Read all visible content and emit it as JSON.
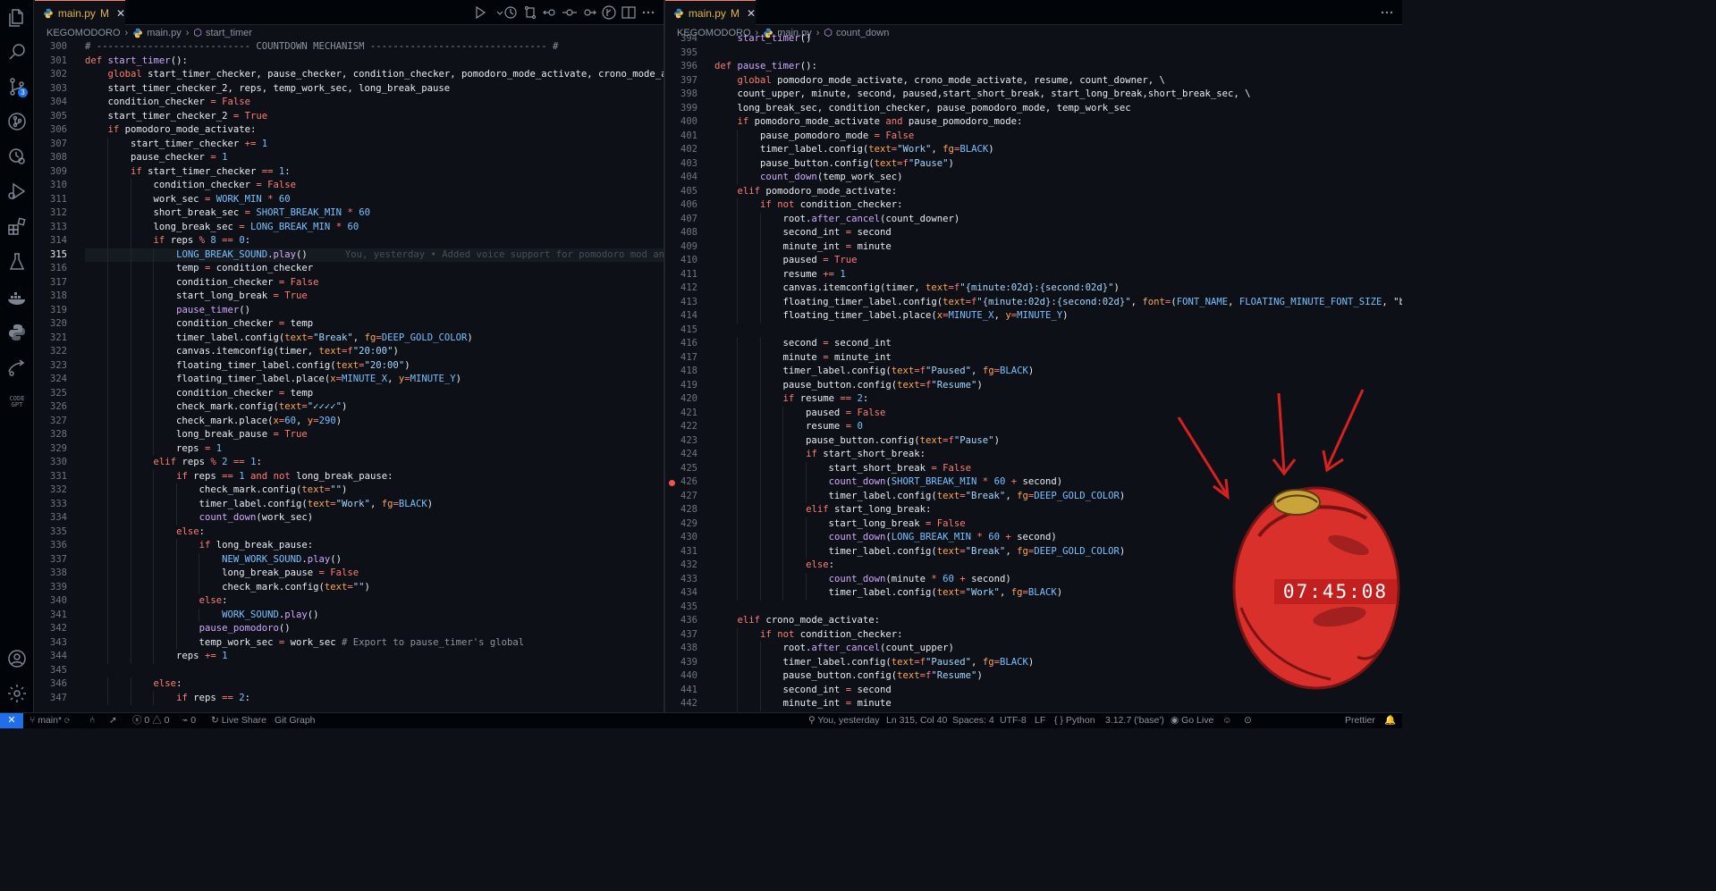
{
  "left_pane": {
    "tab": {
      "filename": "main.py",
      "status": "M"
    },
    "breadcrumb": {
      "project": "KEGOMODORO",
      "file": "main.py",
      "symbol": "start_timer"
    },
    "current_line": 315,
    "blame": "You, yesterday • Added voice support for pomodoro mod and",
    "lines": [
      {
        "n": 300,
        "t": "# --------------------------- COUNTDOWN MECHANISM ------------------------------- #"
      },
      {
        "n": 301,
        "t": "def start_timer():"
      },
      {
        "n": 302,
        "t": "    global start_timer_checker, pause_checker, condition_checker, pomodoro_mode_activate, crono_mode_ac"
      },
      {
        "n": 303,
        "t": "    start_timer_checker_2, reps, temp_work_sec, long_break_pause"
      },
      {
        "n": 304,
        "t": "    condition_checker = False"
      },
      {
        "n": 305,
        "t": "    start_timer_checker_2 = True"
      },
      {
        "n": 306,
        "t": "    if pomodoro_mode_activate:"
      },
      {
        "n": 307,
        "t": "        start_timer_checker += 1"
      },
      {
        "n": 308,
        "t": "        pause_checker = 1"
      },
      {
        "n": 309,
        "t": "        if start_timer_checker == 1:"
      },
      {
        "n": 310,
        "t": "            condition_checker = False"
      },
      {
        "n": 311,
        "t": "            work_sec = WORK_MIN * 60"
      },
      {
        "n": 312,
        "t": "            short_break_sec = SHORT_BREAK_MIN * 60"
      },
      {
        "n": 313,
        "t": "            long_break_sec = LONG_BREAK_MIN * 60"
      },
      {
        "n": 314,
        "t": "            if reps % 8 == 0:"
      },
      {
        "n": 315,
        "t": "                LONG_BREAK_SOUND.play()"
      },
      {
        "n": 316,
        "t": "                temp = condition_checker"
      },
      {
        "n": 317,
        "t": "                condition_checker = False"
      },
      {
        "n": 318,
        "t": "                start_long_break = True"
      },
      {
        "n": 319,
        "t": "                pause_timer()"
      },
      {
        "n": 320,
        "t": "                condition_checker = temp"
      },
      {
        "n": 321,
        "t": "                timer_label.config(text=\"Break\", fg=DEEP_GOLD_COLOR)"
      },
      {
        "n": 322,
        "t": "                canvas.itemconfig(timer, text=f\"20:00\")"
      },
      {
        "n": 323,
        "t": "                floating_timer_label.config(text=\"20:00\")"
      },
      {
        "n": 324,
        "t": "                floating_timer_label.place(x=MINUTE_X, y=MINUTE_Y)"
      },
      {
        "n": 325,
        "t": "                condition_checker = temp"
      },
      {
        "n": 326,
        "t": "                check_mark.config(text=\"✓✓✓✓\")"
      },
      {
        "n": 327,
        "t": "                check_mark.place(x=60, y=290)"
      },
      {
        "n": 328,
        "t": "                long_break_pause = True"
      },
      {
        "n": 329,
        "t": "                reps = 1"
      },
      {
        "n": 330,
        "t": "            elif reps % 2 == 1:"
      },
      {
        "n": 331,
        "t": "                if reps == 1 and not long_break_pause:"
      },
      {
        "n": 332,
        "t": "                    check_mark.config(text=\"\")"
      },
      {
        "n": 333,
        "t": "                    timer_label.config(text=\"Work\", fg=BLACK)"
      },
      {
        "n": 334,
        "t": "                    count_down(work_sec)"
      },
      {
        "n": 335,
        "t": "                else:"
      },
      {
        "n": 336,
        "t": "                    if long_break_pause:"
      },
      {
        "n": 337,
        "t": "                        NEW_WORK_SOUND.play()"
      },
      {
        "n": 338,
        "t": "                        long_break_pause = False"
      },
      {
        "n": 339,
        "t": "                        check_mark.config(text=\"\")"
      },
      {
        "n": 340,
        "t": "                    else:"
      },
      {
        "n": 341,
        "t": "                        WORK_SOUND.play()"
      },
      {
        "n": 342,
        "t": "                    pause_pomodoro()"
      },
      {
        "n": 343,
        "t": "                    temp_work_sec = work_sec # Export to pause_timer's global"
      },
      {
        "n": 344,
        "t": "                reps += 1"
      },
      {
        "n": 345,
        "t": ""
      },
      {
        "n": 346,
        "t": "            else:"
      },
      {
        "n": 347,
        "t": "                if reps == 2:"
      }
    ]
  },
  "right_pane": {
    "tab": {
      "filename": "main.py",
      "status": "M"
    },
    "breadcrumb": {
      "project": "KEGOMODORO",
      "file": "main.py",
      "symbol": "count_down"
    },
    "first_line_partial": {
      "n": 394,
      "t": "    start_timer()"
    },
    "breakpoint_line": 426,
    "lines": [
      {
        "n": 395,
        "t": ""
      },
      {
        "n": 396,
        "t": "def pause_timer():"
      },
      {
        "n": 397,
        "t": "    global pomodoro_mode_activate, crono_mode_activate, resume, count_downer, \\"
      },
      {
        "n": 398,
        "t": "    count_upper, minute, second, paused,start_short_break, start_long_break,short_break_sec, \\"
      },
      {
        "n": 399,
        "t": "    long_break_sec, condition_checker, pause_pomodoro_mode, temp_work_sec"
      },
      {
        "n": 400,
        "t": "    if pomodoro_mode_activate and pause_pomodoro_mode:"
      },
      {
        "n": 401,
        "t": "        pause_pomodoro_mode = False"
      },
      {
        "n": 402,
        "t": "        timer_label.config(text=\"Work\", fg=BLACK)"
      },
      {
        "n": 403,
        "t": "        pause_button.config(text=f\"Pause\")"
      },
      {
        "n": 404,
        "t": "        count_down(temp_work_sec)"
      },
      {
        "n": 405,
        "t": "    elif pomodoro_mode_activate:"
      },
      {
        "n": 406,
        "t": "        if not condition_checker:"
      },
      {
        "n": 407,
        "t": "            root.after_cancel(count_downer)"
      },
      {
        "n": 408,
        "t": "            second_int = second"
      },
      {
        "n": 409,
        "t": "            minute_int = minute"
      },
      {
        "n": 410,
        "t": "            paused = True"
      },
      {
        "n": 411,
        "t": "            resume += 1"
      },
      {
        "n": 412,
        "t": "            canvas.itemconfig(timer, text=f\"{minute:02d}:{second:02d}\")"
      },
      {
        "n": 413,
        "t": "            floating_timer_label.config(text=f\"{minute:02d}:{second:02d}\", font=(FONT_NAME, FLOATING_MINUTE_FONT_SIZE, \"bo"
      },
      {
        "n": 414,
        "t": "            floating_timer_label.place(x=MINUTE_X, y=MINUTE_Y)"
      },
      {
        "n": 415,
        "t": ""
      },
      {
        "n": 416,
        "t": "            second = second_int"
      },
      {
        "n": 417,
        "t": "            minute = minute_int"
      },
      {
        "n": 418,
        "t": "            timer_label.config(text=f\"Paused\", fg=BLACK)"
      },
      {
        "n": 419,
        "t": "            pause_button.config(text=f\"Resume\")"
      },
      {
        "n": 420,
        "t": "            if resume == 2:"
      },
      {
        "n": 421,
        "t": "                paused = False"
      },
      {
        "n": 422,
        "t": "                resume = 0"
      },
      {
        "n": 423,
        "t": "                pause_button.config(text=f\"Pause\")"
      },
      {
        "n": 424,
        "t": "                if start_short_break:"
      },
      {
        "n": 425,
        "t": "                    start_short_break = False"
      },
      {
        "n": 426,
        "t": "                    count_down(SHORT_BREAK_MIN * 60 + second)"
      },
      {
        "n": 427,
        "t": "                    timer_label.config(text=\"Break\", fg=DEEP_GOLD_COLOR)"
      },
      {
        "n": 428,
        "t": "                elif start_long_break:"
      },
      {
        "n": 429,
        "t": "                    start_long_break = False"
      },
      {
        "n": 430,
        "t": "                    count_down(LONG_BREAK_MIN * 60 + second)"
      },
      {
        "n": 431,
        "t": "                    timer_label.config(text=\"Break\", fg=DEEP_GOLD_COLOR)"
      },
      {
        "n": 432,
        "t": "                else:"
      },
      {
        "n": 433,
        "t": "                    count_down(minute * 60 + second)"
      },
      {
        "n": 434,
        "t": "                    timer_label.config(text=\"Work\", fg=BLACK)"
      },
      {
        "n": 435,
        "t": ""
      },
      {
        "n": 436,
        "t": "    elif crono_mode_activate:"
      },
      {
        "n": 437,
        "t": "        if not condition_checker:"
      },
      {
        "n": 438,
        "t": "            root.after_cancel(count_upper)"
      },
      {
        "n": 439,
        "t": "            timer_label.config(text=f\"Paused\", fg=BLACK)"
      },
      {
        "n": 440,
        "t": "            pause_button.config(text=f\"Resume\")"
      },
      {
        "n": 441,
        "t": "            second_int = second"
      },
      {
        "n": 442,
        "t": "            minute_int = minute"
      }
    ]
  },
  "activity_bar": {
    "icons": [
      "explorer-icon",
      "search-icon",
      "source-control-icon",
      "git-graph-icon",
      "timeline-icon",
      "run-debug-icon",
      "extensions-icon",
      "testing-icon",
      "docker-icon",
      "python-icon",
      "remote-icon",
      "codegpt-icon"
    ],
    "badge": "3",
    "bottom_icons": [
      "accounts-icon",
      "settings-icon"
    ]
  },
  "floating_timer": {
    "time": "07:45:08"
  },
  "status_bar": {
    "branch": "main*",
    "errors": "0",
    "warnings": "0",
    "ports": "0",
    "live_share": "Live Share",
    "git_graph": "Git Graph",
    "blame": "You, yesterday",
    "cursor": "Ln 315, Col 40",
    "spaces": "Spaces: 4",
    "encoding": "UTF-8",
    "eol": "LF",
    "language": "Python",
    "interpreter": "3.12.7 ('base')",
    "go_live": "Go Live",
    "prettier": "Prettier"
  },
  "colors": {
    "background": "#0d1117",
    "keyword": "#ff7b72",
    "function": "#d2a8ff",
    "constant": "#79c0ff",
    "string": "#a5d6ff",
    "accent": "#1f6feb",
    "timer_red": "#c21f1f"
  }
}
